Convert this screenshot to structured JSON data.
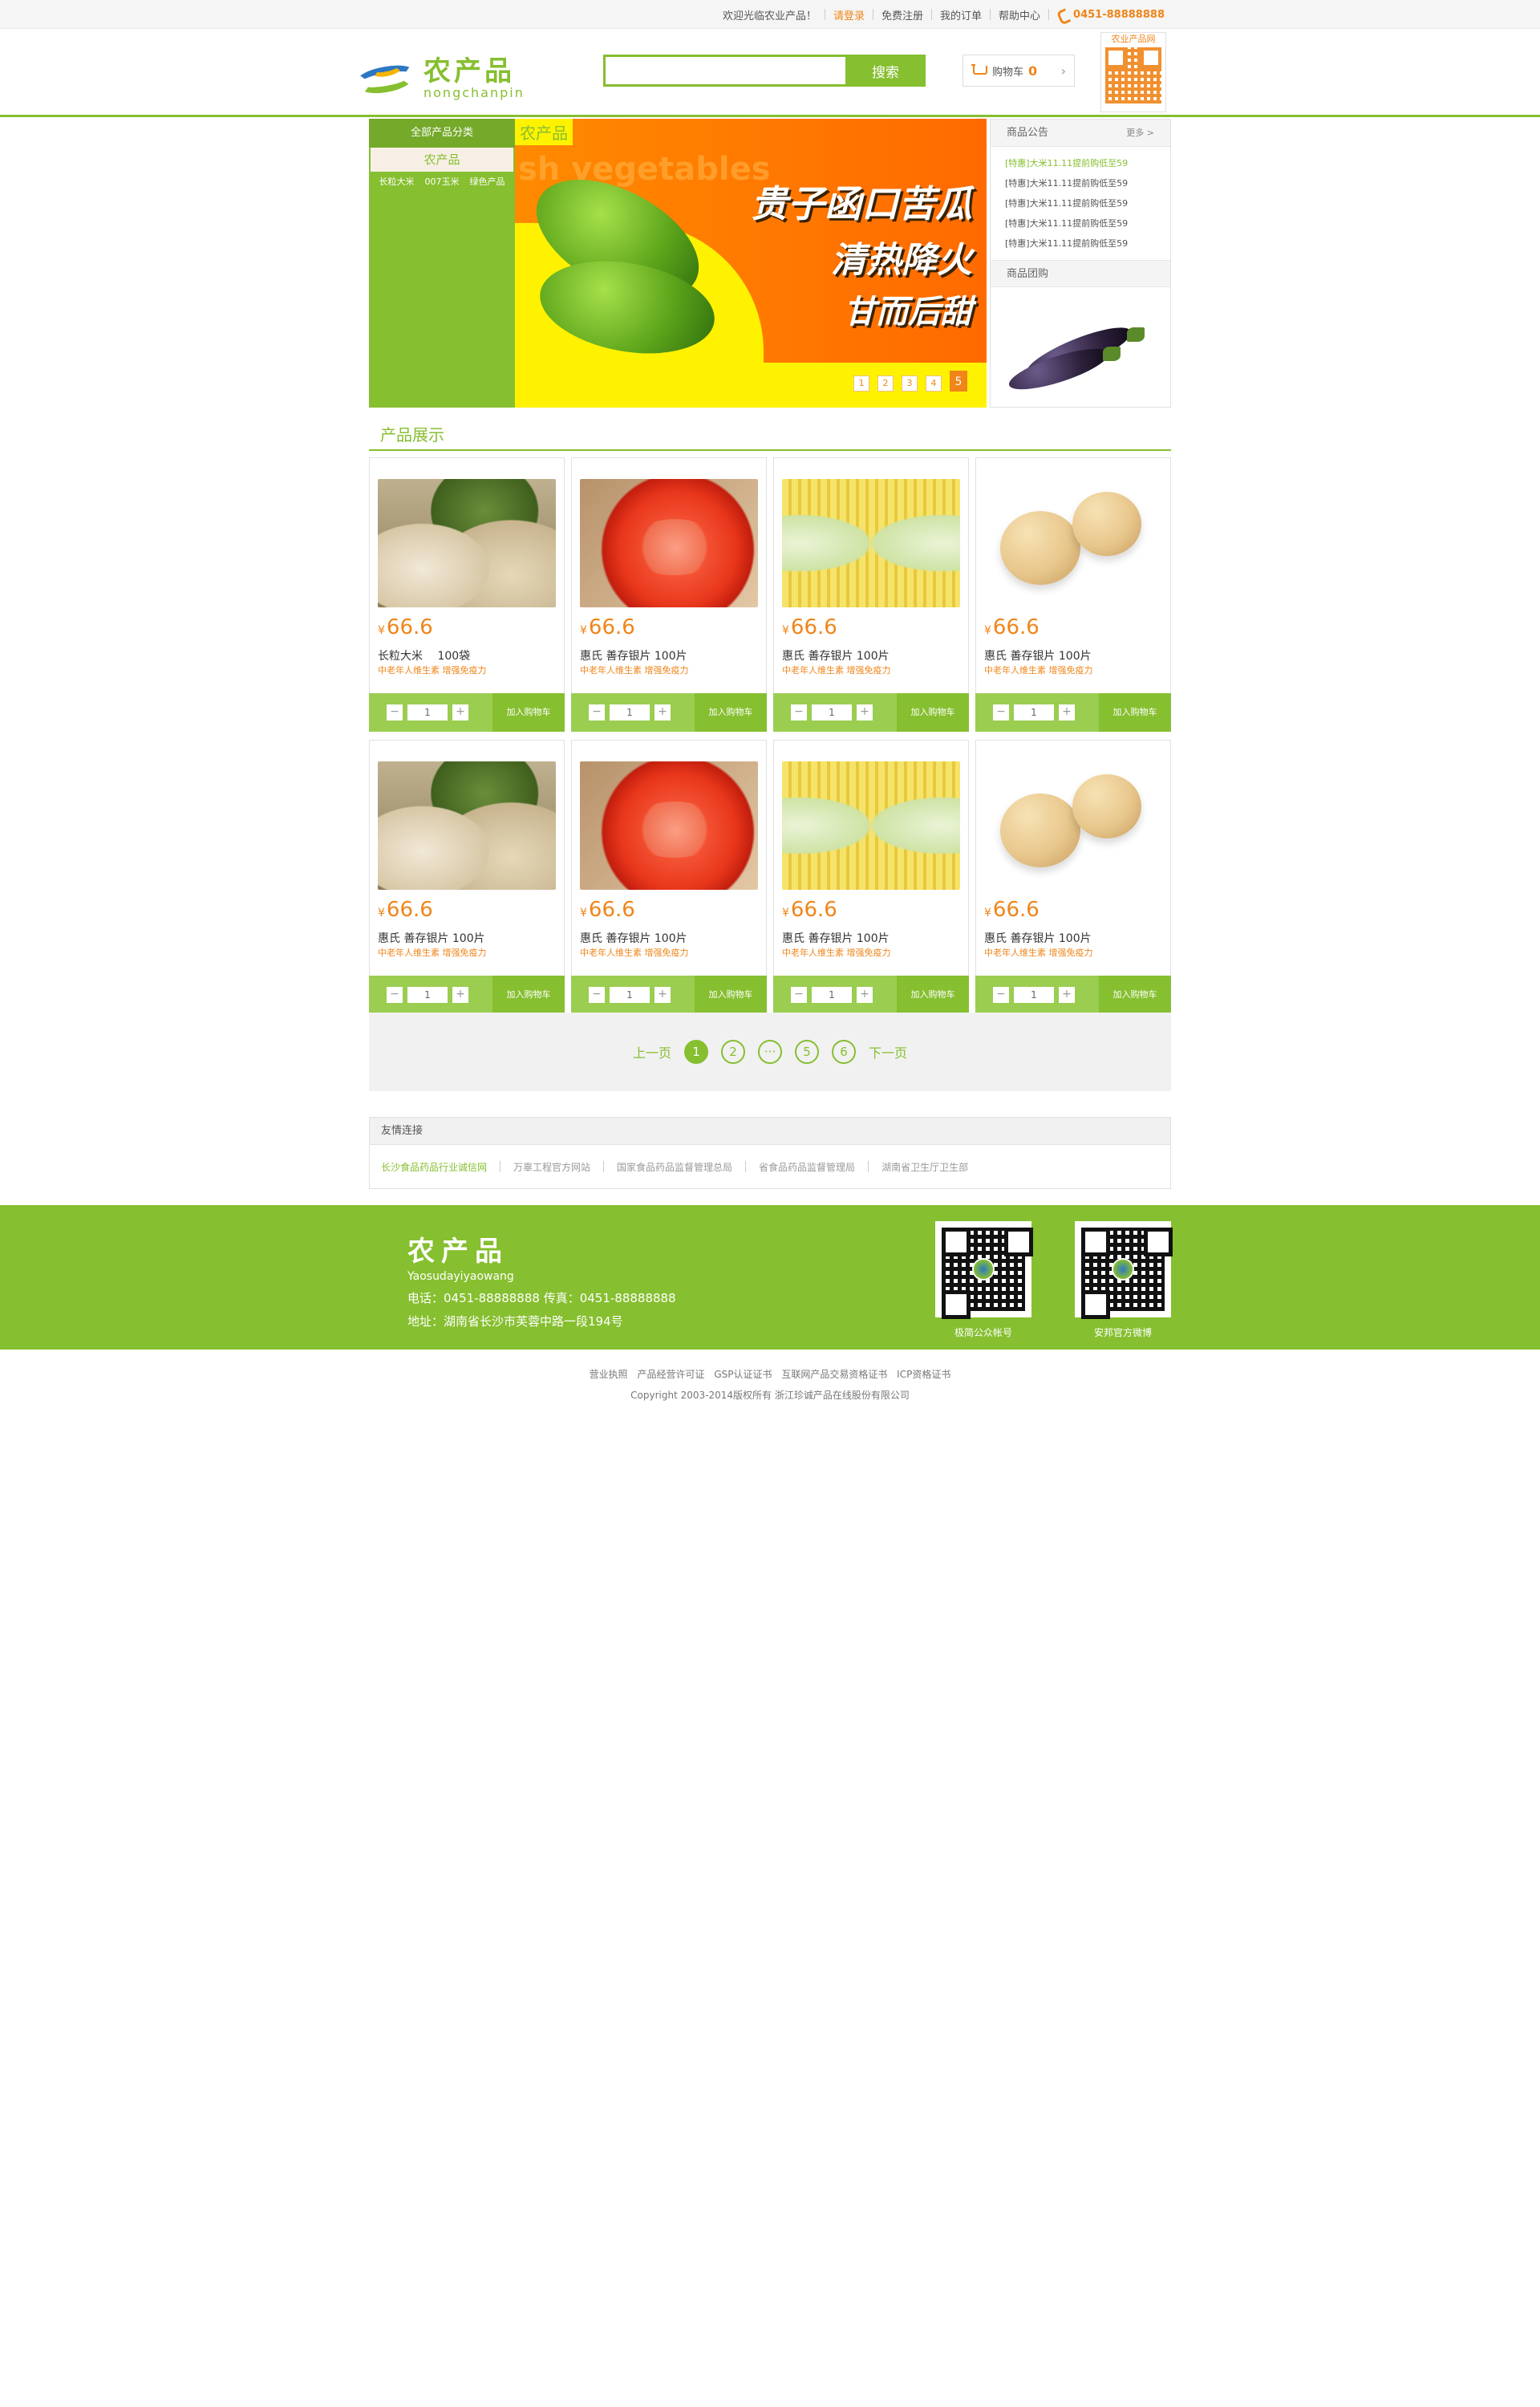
{
  "topbar": {
    "welcome": "欢迎光临农业产品！",
    "login": "请登录",
    "register": "免费注册",
    "orders": "我的订单",
    "help": "帮助中心",
    "phone": "0451-88888888"
  },
  "header": {
    "logo_cn": "农产品",
    "logo_en": "nongchanpin",
    "search_placeholder": "",
    "search_button": "搜索",
    "cart_label": "购物车",
    "cart_count": "0",
    "qr_title": "农业产品网"
  },
  "category": {
    "title": "全部产品分类",
    "subtitle": "农产品",
    "links": [
      "长粒大米",
      "007玉米",
      "绿色产品"
    ]
  },
  "banner": {
    "tag": "农产品",
    "eng": "sh vegetables",
    "slogan1": "贵子函口苦瓜",
    "slogan2": "清热降火",
    "slogan3": "甘而后甜",
    "dots": [
      "1",
      "2",
      "3",
      "4",
      "5"
    ],
    "active_dot": "5"
  },
  "notice": {
    "title": "商品公告",
    "more": "更多 >",
    "items": [
      "[特惠]大米11.11提前购低至59",
      "[特惠]大米11.11提前购低至59",
      "[特惠]大米11.11提前购低至59",
      "[特惠]大米11.11提前购低至59",
      "[特惠]大米11.11提前购低至59"
    ],
    "group_title": "商品团购"
  },
  "products": {
    "title": "产品展示",
    "currency": "¥",
    "add_label": "加入购物车",
    "qty_default": "1",
    "items": [
      {
        "price": "66.6",
        "name": "长粒大米　 100袋",
        "desc": "中老年人维生素 增强免疫力",
        "img": "rice"
      },
      {
        "price": "66.6",
        "name": "惠氏 善存银片 100片",
        "desc": "中老年人维生素 增强免疫力",
        "img": "tomato"
      },
      {
        "price": "66.6",
        "name": "惠氏 善存银片 100片",
        "desc": "中老年人维生素 增强免疫力",
        "img": "corn"
      },
      {
        "price": "66.6",
        "name": "惠氏 善存银片 100片",
        "desc": "中老年人维生素 增强免疫力",
        "img": "potato"
      },
      {
        "price": "66.6",
        "name": "惠氏 善存银片 100片",
        "desc": "中老年人维生素 增强免疫力",
        "img": "rice"
      },
      {
        "price": "66.6",
        "name": "惠氏 善存银片 100片",
        "desc": "中老年人维生素 增强免疫力",
        "img": "tomato"
      },
      {
        "price": "66.6",
        "name": "惠氏 善存银片 100片",
        "desc": "中老年人维生素 增强免疫力",
        "img": "corn"
      },
      {
        "price": "66.6",
        "name": "惠氏 善存银片 100片",
        "desc": "中老年人维生素 增强免疫力",
        "img": "potato"
      }
    ]
  },
  "pager": {
    "prev": "上一页",
    "next": "下一页",
    "pages": [
      "1",
      "2",
      "···",
      "5",
      "6"
    ],
    "active": "1"
  },
  "friends": {
    "title": "友情连接",
    "links": [
      "长沙食品药品行业诚信网",
      "万辜工程官方网站",
      "国家食品药品监督管理总局",
      "省食品药品监督管理局",
      "湖南省卫生厅卫生部"
    ]
  },
  "footer": {
    "brand_cn": "农产品",
    "brand_en": "Yaosudayiyaowang",
    "contact": "电话：0451-88888888  传真：0451-88888888",
    "address": "地址：湖南省长沙市芙蓉中路一段194号",
    "qr1_caption": "极简公众帐号",
    "qr2_caption": "安邦官方微博"
  },
  "bottom": {
    "links": [
      "营业执照",
      "产品经营许可证",
      "GSP认证证书",
      "互联网产品交易资格证书",
      "ICP资格证书"
    ],
    "copyright": "Copyright 2003-2014版权所有 浙江珍诚产品在线股份有限公司"
  },
  "colors": {
    "brand_green": "#86bf2f",
    "accent_orange": "#f08519"
  }
}
